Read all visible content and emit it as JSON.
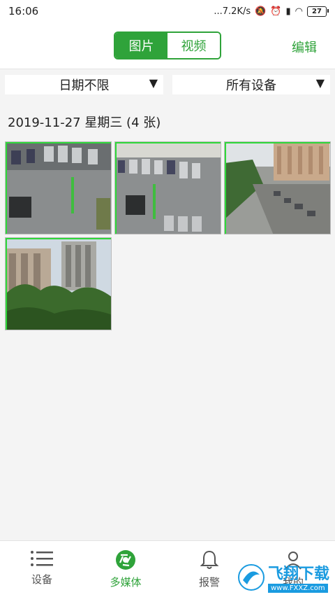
{
  "status_bar": {
    "time": "16:06",
    "network_speed": "...7.2K/s",
    "battery": "27"
  },
  "header": {
    "tabs": [
      {
        "label": "图片",
        "active": true
      },
      {
        "label": "视频",
        "active": false
      }
    ],
    "edit_label": "编辑"
  },
  "filters": {
    "date": "日期不限",
    "device": "所有设备",
    "arrow": "▼"
  },
  "gallery": {
    "date_title": "2019-11-27  星期三  (4 张)",
    "photos": [
      {
        "scene": "parking-lot"
      },
      {
        "scene": "parking-lot"
      },
      {
        "scene": "street-buildings"
      },
      {
        "scene": "buildings-trees"
      }
    ]
  },
  "tabbar": {
    "items": [
      {
        "label": "设备",
        "icon": "list-icon",
        "active": false
      },
      {
        "label": "多媒体",
        "icon": "aperture-icon",
        "active": true
      },
      {
        "label": "报警",
        "icon": "bell-icon",
        "active": false
      },
      {
        "label": "我的",
        "icon": "person-icon",
        "active": false
      }
    ]
  },
  "watermark": {
    "title": "飞翔下载",
    "url": "www.FXXZ.com"
  },
  "colors": {
    "accent": "#2fa33a",
    "watermark": "#1a9be0"
  }
}
